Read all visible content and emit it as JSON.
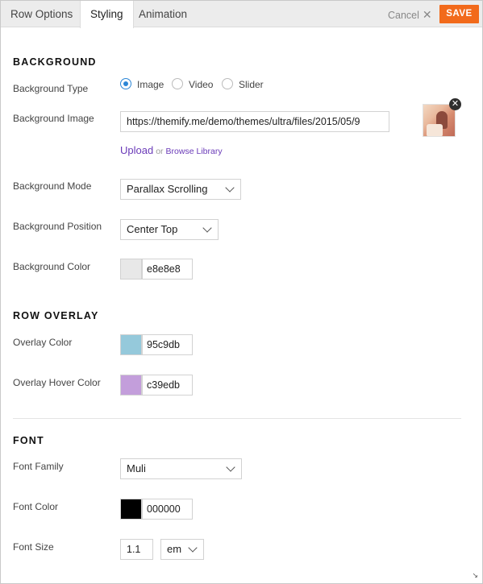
{
  "tabs": {
    "row_options": "Row Options",
    "styling": "Styling",
    "animation": "Animation"
  },
  "header": {
    "cancel_label": "Cancel",
    "cancel_icon": "close-x-icon",
    "save_label": "SAVE",
    "save_color": "#f26a1b"
  },
  "background": {
    "heading": "BACKGROUND",
    "type_label": "Background Type",
    "type_options": [
      "Image",
      "Video",
      "Slider"
    ],
    "type_selected": "Image",
    "image_label": "Background Image",
    "image_url": "https://themify.me/demo/themes/ultra/files/2015/05/9",
    "upload_label": "Upload",
    "or_text": "or",
    "browse_label": "Browse Library",
    "mode_label": "Background Mode",
    "mode_value": "Parallax Scrolling",
    "position_label": "Background Position",
    "position_value": "Center Top",
    "color_label": "Background Color",
    "color_value": "e8e8e8",
    "color_hex": "#e8e8e8"
  },
  "overlay": {
    "heading": "ROW OVERLAY",
    "color_label": "Overlay Color",
    "color_value": "95c9db",
    "color_hex": "#95c9db",
    "hover_label": "Overlay Hover Color",
    "hover_value": "c39edb",
    "hover_hex": "#c39edb"
  },
  "font": {
    "heading": "FONT",
    "family_label": "Font Family",
    "family_value": "Muli",
    "color_label": "Font Color",
    "color_value": "000000",
    "color_hex": "#000000",
    "size_label": "Font Size",
    "size_value": "1.1",
    "size_unit": "em"
  },
  "accent_color": "#2b86d6"
}
